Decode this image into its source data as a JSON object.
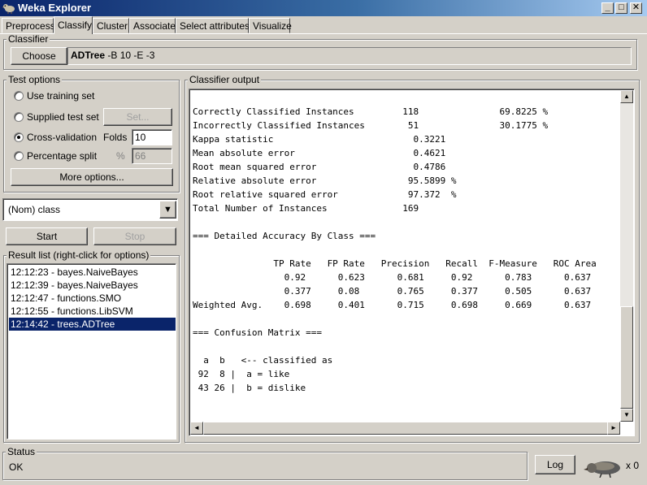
{
  "window": {
    "title": "Weka Explorer",
    "minimize": "_",
    "maximize": "□",
    "close": "✕"
  },
  "tabs": [
    "Preprocess",
    "Classify",
    "Cluster",
    "Associate",
    "Select attributes",
    "Visualize"
  ],
  "active_tab": "Classify",
  "classifier": {
    "group_label": "Classifier",
    "choose_label": "Choose",
    "name": "ADTree",
    "options": " -B 10 -E -3"
  },
  "test_options": {
    "group_label": "Test options",
    "use_training_set": "Use training set",
    "supplied_test_set": "Supplied test set",
    "set_button": "Set...",
    "cross_validation": "Cross-validation",
    "folds_label": "Folds",
    "folds_value": "10",
    "percentage_split": "Percentage split",
    "percent_symbol": "%",
    "percent_value": "66",
    "selected": "cross_validation",
    "more_options": "More options..."
  },
  "class_select": {
    "value": "(Nom) class",
    "arrow": "▼"
  },
  "actions": {
    "start": "Start",
    "stop": "Stop"
  },
  "result_list": {
    "group_label": "Result list (right-click for options)",
    "items": [
      "12:12:23 - bayes.NaiveBayes",
      "12:12:39 - bayes.NaiveBayes",
      "12:12:47 - functions.SMO",
      "12:12:55 - functions.LibSVM",
      "12:14:42 - trees.ADTree"
    ],
    "selected_index": 4
  },
  "output": {
    "group_label": "Classifier output",
    "lines": [
      "Correctly Classified Instances         118               69.8225 %",
      "Incorrectly Classified Instances        51               30.1775 %",
      "Kappa statistic                          0.3221",
      "Mean absolute error                      0.4621",
      "Root mean squared error                  0.4786",
      "Relative absolute error                 95.5899 %",
      "Root relative squared error             97.372  %",
      "Total Number of Instances              169",
      "",
      "=== Detailed Accuracy By Class ===",
      "",
      "               TP Rate   FP Rate   Precision   Recall  F-Measure   ROC Area",
      "                 0.92      0.623      0.681     0.92      0.783      0.637",
      "                 0.377     0.08       0.765     0.377     0.505      0.637",
      "Weighted Avg.    0.698     0.401      0.715     0.698     0.669      0.637",
      "",
      "=== Confusion Matrix ===",
      "",
      "  a  b   <-- classified as",
      " 92  8 |  a = like",
      " 43 26 |  b = dislike"
    ],
    "scroll_up": "▲",
    "scroll_down": "▼",
    "scroll_left": "◄",
    "scroll_right": "►"
  },
  "status": {
    "group_label": "Status",
    "text": "OK",
    "log_button": "Log",
    "task_count": "x 0"
  },
  "colors": {
    "face": "#d4d0c8",
    "title_start": "#0a246a",
    "title_end": "#a6caf0",
    "selection": "#0a246a"
  }
}
